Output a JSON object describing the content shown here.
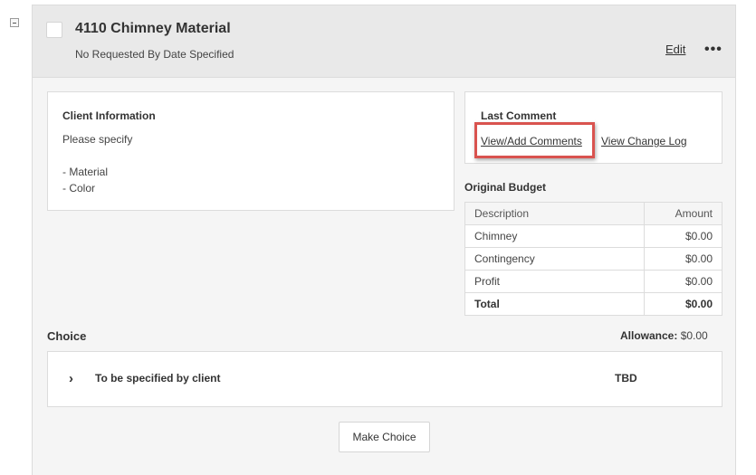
{
  "item": {
    "title": "4110 Chimney Material",
    "subtitle": "No Requested By Date Specified",
    "edit_label": "Edit",
    "more_label": "•••"
  },
  "client_info": {
    "heading": "Client Information",
    "lines": [
      "Please specify",
      "- Material",
      "- Color"
    ]
  },
  "last_comment": {
    "heading": "Last Comment",
    "view_add_label": "View/Add Comments",
    "change_log_label": "View Change Log"
  },
  "budget": {
    "title": "Original Budget",
    "headers": [
      "Description",
      "Amount"
    ],
    "rows": [
      {
        "description": "Chimney",
        "amount": "$0.00"
      },
      {
        "description": "Contingency",
        "amount": "$0.00"
      },
      {
        "description": "Profit",
        "amount": "$0.00"
      }
    ],
    "total": {
      "description": "Total",
      "amount": "$0.00"
    }
  },
  "choice": {
    "label": "Choice",
    "allowance_label": "Allowance:",
    "allowance_value": "$0.00",
    "option_name": "To be specified by client",
    "option_status": "TBD",
    "chevron": "›",
    "make_choice_label": "Make Choice"
  },
  "colors": {
    "highlight": "#d9534f",
    "header_bg": "#e9e9e9",
    "card_bg": "#f5f5f5"
  }
}
